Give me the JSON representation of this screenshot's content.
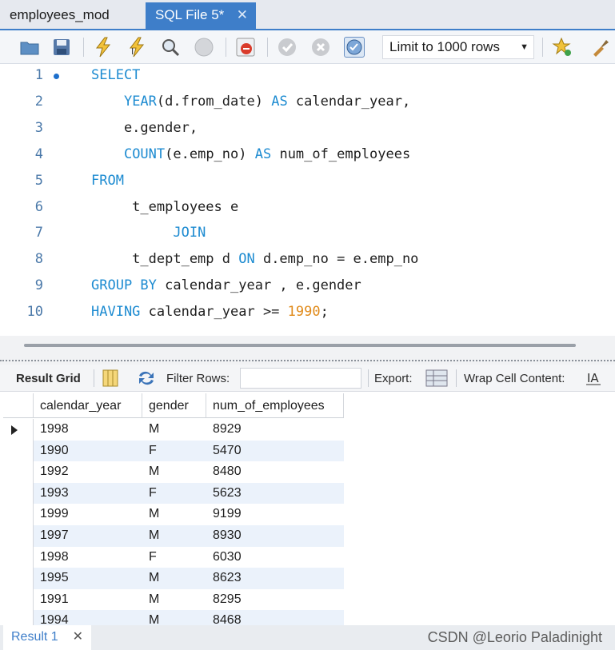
{
  "tabs": [
    {
      "label": "employees_mod"
    },
    {
      "label": "SQL File 5*"
    }
  ],
  "toolbar": {
    "limit_label": "Limit to 1000 rows",
    "icons": [
      "open-file-icon",
      "save-icon",
      "execute-icon",
      "execute-current-icon",
      "explain-icon",
      "stop-icon",
      "toggle-error-icon",
      "commit-icon",
      "rollback-icon",
      "autocommit-icon",
      "bookmark-icon",
      "beautify-icon"
    ]
  },
  "editor": {
    "lines": [
      {
        "num": "1",
        "parts": [
          {
            "t": "SELECT",
            "k": "kw"
          }
        ]
      },
      {
        "num": "2",
        "parts": [
          {
            "t": "    ",
            "k": ""
          },
          {
            "t": "YEAR",
            "k": "kw"
          },
          {
            "t": "(d.from_date) ",
            "k": ""
          },
          {
            "t": "AS",
            "k": "kw"
          },
          {
            "t": " calendar_year,",
            "k": ""
          }
        ]
      },
      {
        "num": "3",
        "parts": [
          {
            "t": "    e.gender,",
            "k": ""
          }
        ]
      },
      {
        "num": "4",
        "parts": [
          {
            "t": "    ",
            "k": ""
          },
          {
            "t": "COUNT",
            "k": "kw"
          },
          {
            "t": "(e.emp_no) ",
            "k": ""
          },
          {
            "t": "AS",
            "k": "kw"
          },
          {
            "t": " num_of_employees",
            "k": ""
          }
        ]
      },
      {
        "num": "5",
        "parts": [
          {
            "t": "FROM",
            "k": "kw"
          }
        ]
      },
      {
        "num": "6",
        "parts": [
          {
            "t": "     t_employees e",
            "k": ""
          }
        ]
      },
      {
        "num": "7",
        "parts": [
          {
            "t": "          ",
            "k": ""
          },
          {
            "t": "JOIN",
            "k": "kw"
          }
        ]
      },
      {
        "num": "8",
        "parts": [
          {
            "t": "     t_dept_emp d ",
            "k": ""
          },
          {
            "t": "ON",
            "k": "kw"
          },
          {
            "t": " d.emp_no = e.emp_no",
            "k": ""
          }
        ]
      },
      {
        "num": "9",
        "parts": [
          {
            "t": "GROUP BY",
            "k": "kw"
          },
          {
            "t": " calendar_year , e.gender",
            "k": ""
          }
        ]
      },
      {
        "num": "10",
        "parts": [
          {
            "t": "HAVING",
            "k": "kw"
          },
          {
            "t": " calendar_year >= ",
            "k": ""
          },
          {
            "t": "1990",
            "k": "num"
          },
          {
            "t": ";",
            "k": ""
          }
        ]
      }
    ]
  },
  "result_toolbar": {
    "result_grid": "Result Grid",
    "filter_rows": "Filter Rows:",
    "filter_value": "",
    "export": "Export:",
    "wrap": "Wrap Cell Content:"
  },
  "grid": {
    "columns": [
      "calendar_year",
      "gender",
      "num_of_employees"
    ],
    "rows": [
      [
        "1998",
        "M",
        "8929"
      ],
      [
        "1990",
        "F",
        "5470"
      ],
      [
        "1992",
        "M",
        "8480"
      ],
      [
        "1993",
        "F",
        "5623"
      ],
      [
        "1999",
        "M",
        "9199"
      ],
      [
        "1997",
        "M",
        "8930"
      ],
      [
        "1998",
        "F",
        "6030"
      ],
      [
        "1995",
        "M",
        "8623"
      ],
      [
        "1991",
        "M",
        "8295"
      ],
      [
        "1994",
        "M",
        "8468"
      ]
    ]
  },
  "bottom": {
    "result_tab": "Result 1",
    "watermark": "CSDN @Leorio Paladinight"
  }
}
